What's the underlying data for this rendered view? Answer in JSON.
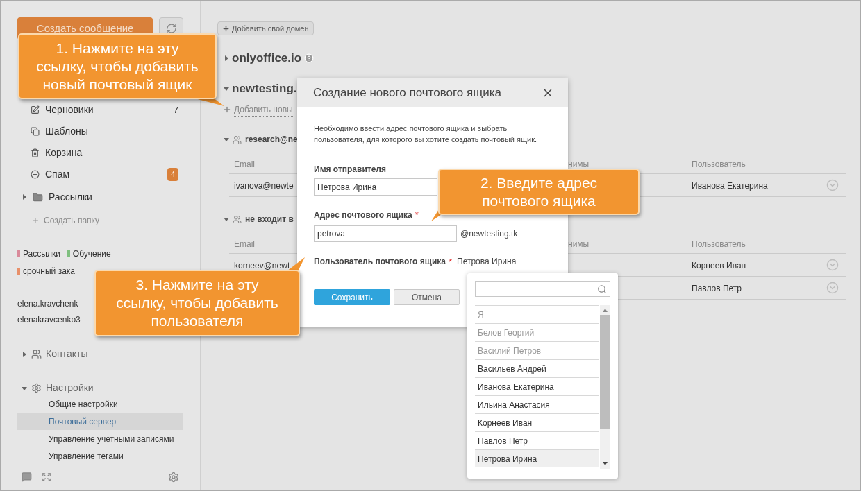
{
  "sidebar": {
    "create_button": "Создать сообщение",
    "folders": [
      {
        "label": "Черновики",
        "count": "7"
      },
      {
        "label": "Шаблоны"
      },
      {
        "label": "Корзина"
      },
      {
        "label": "Спам",
        "badge": "4"
      }
    ],
    "folder_group": {
      "label": "Рассылки",
      "expanded": false
    },
    "create_folder": "Создать папку",
    "tags": [
      {
        "label": "Рассылки",
        "color": "#d98a9a"
      },
      {
        "label": "Обучение",
        "color": "#7fbf7f"
      },
      {
        "label": "срочный зака",
        "color": "#e8906a"
      }
    ],
    "accounts": [
      "elena.kravchenk",
      "elenakravcenko3"
    ],
    "contacts": {
      "label": "Контакты",
      "expanded": false
    },
    "settings": {
      "label": "Настройки",
      "expanded": true,
      "items": [
        {
          "label": "Общие настройки",
          "selected": false
        },
        {
          "label": "Почтовый сервер",
          "selected": true
        },
        {
          "label": "Управление учетными записями",
          "selected": false
        },
        {
          "label": "Управление тегами",
          "selected": false
        }
      ]
    }
  },
  "main": {
    "add_domain_button": "Добавить свой домен",
    "domains": [
      {
        "name": "onlyoffice.io",
        "expanded": false
      },
      {
        "name": "newtesting.",
        "expanded": true
      }
    ],
    "add_mailbox_link": "Добавить новы",
    "groups": [
      {
        "name": "research@ne",
        "expanded": true,
        "columns": [
          "Email",
          "нимы",
          "Пользователь"
        ],
        "rows": [
          {
            "email": "ivanova@newte",
            "user": "Иванова Екатерина"
          }
        ]
      },
      {
        "name": "не входит в",
        "expanded": true,
        "columns": [
          "Email",
          "нимы",
          "Пользователь"
        ],
        "rows": [
          {
            "email": "korneev@newt",
            "user": "Корнеев Иван"
          },
          {
            "user": "Павлов Петр"
          }
        ]
      }
    ]
  },
  "dialog": {
    "title": "Создание нового почтового ящика",
    "description": "Необходимо ввести адрес почтового ящика и выбрать пользователя, для которого вы хотите создать почтовый ящик.",
    "sender_label": "Имя отправителя",
    "sender_value": "Петрова Ирина",
    "address_label": "Адрес почтового ящика",
    "address_value": "petrova",
    "domain": "@newtesting.tk",
    "user_label": "Пользователь почтового ящика",
    "user_link": "Петрова Ирина",
    "required_mark": "*",
    "save_button": "Сохранить",
    "cancel_button": "Отмена"
  },
  "user_dropdown": {
    "items": [
      {
        "label": "Я",
        "disabled": true,
        "selected": false
      },
      {
        "label": "Белов Георгий",
        "disabled": true,
        "selected": false
      },
      {
        "label": "Василий Петров",
        "disabled": true,
        "selected": false
      },
      {
        "label": "Васильев Андрей",
        "disabled": false,
        "selected": false
      },
      {
        "label": "Иванова Екатерина",
        "disabled": false,
        "selected": false
      },
      {
        "label": "Ильина Анастасия",
        "disabled": false,
        "selected": false
      },
      {
        "label": "Корнеев Иван",
        "disabled": false,
        "selected": false
      },
      {
        "label": "Павлов Петр",
        "disabled": false,
        "selected": false
      },
      {
        "label": "Петрова Ирина",
        "disabled": false,
        "selected": true
      }
    ]
  },
  "callouts": [
    "1. Нажмите на эту\nссылку, чтобы добавить\nновый почтовый ящик",
    "2. Введите адрес\nпочтового ящика",
    "3. Нажмите на эту\nссылку, чтобы добавить\nпользователя"
  ]
}
